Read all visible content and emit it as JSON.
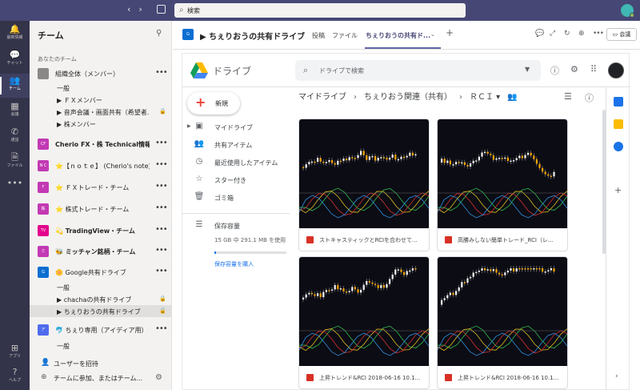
{
  "titlebar": {
    "search_placeholder": "検索",
    "nav_back": "‹",
    "nav_forward": "›"
  },
  "rail": {
    "items": [
      {
        "label": "最新情報",
        "icon": "bell-icon",
        "glyph": "🔔"
      },
      {
        "label": "チャット",
        "icon": "chat-icon",
        "glyph": "💬"
      },
      {
        "label": "チーム",
        "icon": "teams-icon",
        "glyph": "👥"
      },
      {
        "label": "会議",
        "icon": "calendar-icon",
        "glyph": "▦"
      },
      {
        "label": "通話",
        "icon": "phone-icon",
        "glyph": "✆"
      },
      {
        "label": "ファイル",
        "icon": "file-icon",
        "glyph": "🗎"
      },
      {
        "label": "",
        "icon": "more-icon",
        "glyph": "•••"
      }
    ],
    "bottom": [
      {
        "label": "アプリ",
        "icon": "apps-icon",
        "glyph": "⊞"
      },
      {
        "label": "ヘルプ",
        "icon": "help-icon",
        "glyph": "?"
      }
    ]
  },
  "teamlist": {
    "header": "チーム",
    "section": "あなたのチーム",
    "teams": [
      {
        "avatar": "",
        "color": "#8a8886",
        "name": "組織全体（メンバー）",
        "bold": false
      },
      {
        "avatar": "CF",
        "color": "#c239b3",
        "name": "Cherio FX・株 Technical情報",
        "bold": true
      },
      {
        "avatar": "N C",
        "color": "#c239b3",
        "name": "⭐【ｎｏｔｅ】 (Cherio's note)",
        "bold": false
      },
      {
        "avatar": "Ｆ",
        "color": "#c239b3",
        "name": "⭐ ＦＸトレード・チーム",
        "bold": false
      },
      {
        "avatar": "株",
        "color": "#c239b3",
        "name": "⭐ 株式トレード・チーム",
        "bold": false
      },
      {
        "avatar": "TV",
        "color": "#e3008c",
        "name": "💫 TradingView・チーム",
        "bold": true
      },
      {
        "avatar": "ミ",
        "color": "#c239b3",
        "name": "🐝 ミッチャン銘柄・チーム",
        "bold": true
      },
      {
        "avatar": "G",
        "color": "#0a6ed1",
        "name": "🌼 Google共有ドライブ",
        "bold": false
      },
      {
        "avatar": "ア",
        "color": "#4f6bed",
        "name": "🐬 ちぇり専用（アイディア用）",
        "bold": false
      }
    ],
    "channels_team1": [
      {
        "name": "一般",
        "lock": false
      },
      {
        "name": "▶ ＦＸメンバー",
        "lock": false
      },
      {
        "name": "▶ 音声会議・画面共有（希望者...",
        "lock": true
      },
      {
        "name": "▶ 株メンバー",
        "lock": false
      }
    ],
    "channels_google": [
      {
        "name": "一般",
        "lock": false
      },
      {
        "name": "▶ chachaの共有ドライブ",
        "lock": true
      },
      {
        "name": "▶ ちぇりおうの共有ドライブ",
        "lock": true
      }
    ],
    "channels_idea": [
      {
        "name": "一般",
        "lock": false
      }
    ],
    "footer": {
      "invite": "ユーザーを招待",
      "join": "チームに参加、またはチーム..."
    }
  },
  "channel_header": {
    "avatar": "G",
    "title": "▶ ちぇりおうの共有ドライブ",
    "tabs": [
      "投稿",
      "ファイル",
      "ちぇりおうの共有ド..."
    ],
    "meet_label": "会議"
  },
  "drive": {
    "name": "ドライブ",
    "search_placeholder": "ドライブで検索",
    "new_label": "新規",
    "nav": [
      {
        "label": "マイドライブ",
        "icon": "my-drive-icon",
        "glyph": "▣",
        "arrow": true
      },
      {
        "label": "共有アイテム",
        "icon": "shared-icon",
        "glyph": "👥",
        "arrow": false
      },
      {
        "label": "最近使用したアイテム",
        "icon": "clock-icon",
        "glyph": "◷",
        "arrow": false
      },
      {
        "label": "スター付き",
        "icon": "star-icon",
        "glyph": "☆",
        "arrow": false
      },
      {
        "label": "ゴミ箱",
        "icon": "trash-icon",
        "glyph": "🗑",
        "arrow": false
      }
    ],
    "storage_label": "保存容量",
    "storage_text": "15 GB 中 291.1 MB を使用",
    "storage_fraction": 0.019,
    "storage_buy": "保存容量を購入",
    "breadcrumbs": [
      "マイドライブ",
      "ちぇりおう関連（共有）",
      "ＲＣＩ ▾"
    ],
    "files": [
      {
        "name": "ストキャスティックとRCIを合わせて..."
      },
      {
        "name": "高勝みしない簡単トレード_RCI（レ..."
      },
      {
        "name": "上昇トレンド&RCI 2018-06-16 10.1..."
      },
      {
        "name": "上昇トレンド&RCI 2018-06-16 10.1..."
      }
    ]
  }
}
